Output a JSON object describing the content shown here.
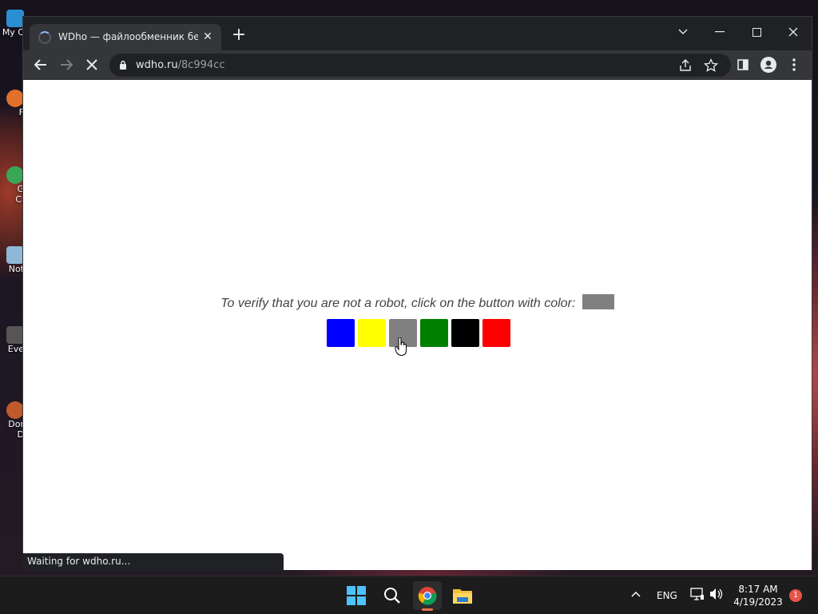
{
  "desktop": {
    "icons": [
      {
        "label": "My C",
        "icon": "computer-icon",
        "color": "#2a8fd0"
      },
      {
        "label": "F",
        "icon": "firefox-icon",
        "color": "#e0702a"
      },
      {
        "label": "G\nCl",
        "icon": "chrome-shortcut-icon",
        "color": "#3aa757"
      },
      {
        "label": "Not",
        "icon": "notepad-icon",
        "color": "#8fb8d8"
      },
      {
        "label": "Eve",
        "icon": "event-icon",
        "color": "#555"
      },
      {
        "label": "Dor\nD",
        "icon": "donut-icon",
        "color": "#c05a2a"
      }
    ]
  },
  "browser": {
    "tab": {
      "title": "WDho — файлообменник беспл",
      "close": "✕"
    },
    "new_tab": "+",
    "url_domain": "wdho.ru",
    "url_path": "/8c994cc",
    "status": "Waiting for wdho.ru..."
  },
  "page": {
    "verify_text": "To verify that you are not a robot, click on the button with color:",
    "target_color": "#808080",
    "buttons": [
      {
        "name": "blue",
        "color": "#0000ff"
      },
      {
        "name": "yellow",
        "color": "#ffff00"
      },
      {
        "name": "gray",
        "color": "#808080"
      },
      {
        "name": "green",
        "color": "#008000"
      },
      {
        "name": "black",
        "color": "#000000"
      },
      {
        "name": "red",
        "color": "#ff0000"
      }
    ]
  },
  "taskbar": {
    "lang": "ENG",
    "time": "8:17 AM",
    "date": "4/19/2023",
    "notifications": "1"
  }
}
